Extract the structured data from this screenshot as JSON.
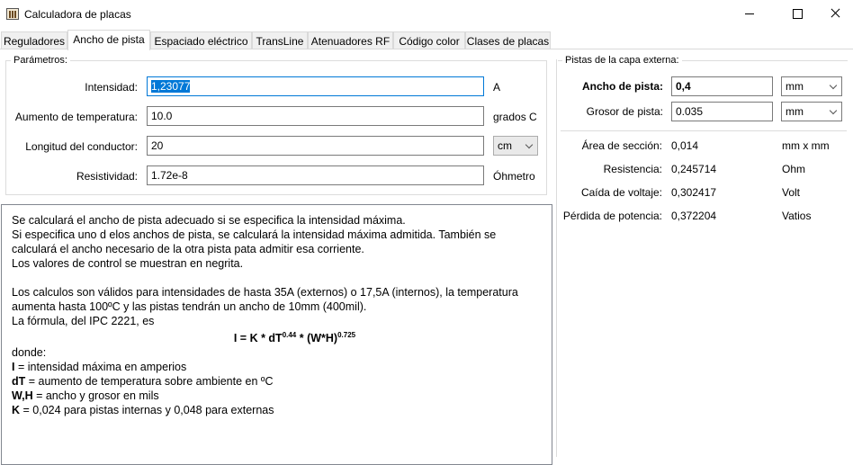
{
  "window": {
    "title": "Calculadora de placas",
    "icon": "calculator-app-icon"
  },
  "tabs": [
    {
      "label": "Reguladores"
    },
    {
      "label": "Ancho de pista"
    },
    {
      "label": "Espaciado eléctrico"
    },
    {
      "label": "TransLine"
    },
    {
      "label": "Atenuadores RF"
    },
    {
      "label": "Código color"
    },
    {
      "label": "Clases de placas"
    }
  ],
  "active_tab": "Ancho de pista",
  "params": {
    "legend": "Parámetros:",
    "current_label": "Intensidad:",
    "current_value": "1,23077",
    "current_unit": "A",
    "temp_label": "Aumento de temperatura:",
    "temp_value": "10.0",
    "temp_unit": "grados C",
    "length_label": "Longitud del conductor:",
    "length_value": "20",
    "length_unit": "cm",
    "resist_label": "Resistividad:",
    "resist_value": "1.72e-8",
    "resist_unit": "Óhmetro"
  },
  "external": {
    "legend": "Pistas de la capa externa:",
    "width_label": "Ancho de pista:",
    "width_value": "0,4",
    "width_unit": "mm",
    "thick_label": "Grosor de pista:",
    "thick_value": "0.035",
    "thick_unit": "mm",
    "area_label": "Área de sección:",
    "area_value": "0,014",
    "area_unit": "mm x mm",
    "resistance_label": "Resistencia:",
    "resistance_value": "0,245714",
    "resistance_unit": "Ohm",
    "drop_label": "Caída de voltaje:",
    "drop_value": "0,302417",
    "drop_unit": "Volt",
    "loss_label": "Pérdida de potencia:",
    "loss_value": "0,372204",
    "loss_unit": "Vatios"
  },
  "info": {
    "line1": "Se calculará el ancho de pista adecuado si se especifica la intensidad máxima.",
    "line2": "Si especifica uno d elos anchos de pista, se calculará la intensidad máxima admitida. También se calculará el ancho necesario de la otra pista pata admitir esa corriente.",
    "line3": "Los valores de control se muestran en negrita.",
    "line4": "Los calculos son válidos para intensidades de hasta 35A (externos) o 17,5A (internos), la temperatura aumenta hasta 100ºC y las pistas tendrán un ancho de 10mm (400mil).",
    "line5": "La fórmula, del IPC 2221, es",
    "formula_a": "I = K * dT",
    "formula_exp1": "0.44",
    "formula_b": " * (W*H)",
    "formula_exp2": "0.725",
    "line6": "donde:",
    "def1_key": "I",
    "def1_text": " = intensidad máxima en amperios",
    "def2_key": "dT",
    "def2_text": " = aumento de temperatura sobre ambiente en ºC",
    "def3_key": "W,H",
    "def3_text": " = ancho y grosor en mils",
    "def4_key": "K",
    "def4_text": " = 0,024 para pistas internas y 0,048 para externas"
  }
}
